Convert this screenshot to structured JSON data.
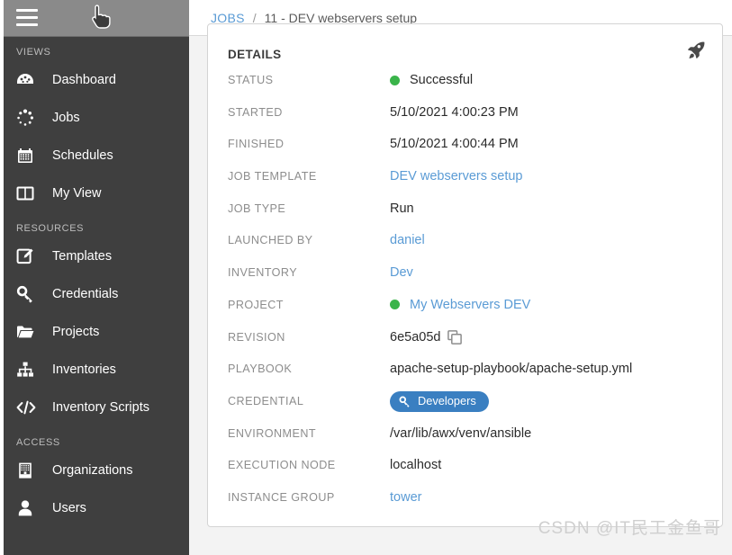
{
  "topbar": {
    "menu_icon": "hamburger-icon",
    "cursor": "pointing-hand-cursor"
  },
  "sidebar": {
    "sections": [
      {
        "title": "VIEWS",
        "items": [
          {
            "label": "Dashboard",
            "icon": "dashboard-icon"
          },
          {
            "label": "Jobs",
            "icon": "jobs-spinner-icon"
          },
          {
            "label": "Schedules",
            "icon": "calendar-icon"
          },
          {
            "label": "My View",
            "icon": "columns-icon"
          }
        ]
      },
      {
        "title": "RESOURCES",
        "items": [
          {
            "label": "Templates",
            "icon": "template-edit-icon"
          },
          {
            "label": "Credentials",
            "icon": "key-icon"
          },
          {
            "label": "Projects",
            "icon": "folder-icon"
          },
          {
            "label": "Inventories",
            "icon": "sitemap-icon"
          },
          {
            "label": "Inventory Scripts",
            "icon": "code-icon"
          }
        ]
      },
      {
        "title": "ACCESS",
        "items": [
          {
            "label": "Organizations",
            "icon": "building-icon"
          },
          {
            "label": "Users",
            "icon": "user-icon"
          }
        ]
      }
    ]
  },
  "breadcrumb": {
    "root": "JOBS",
    "separator": "/",
    "current": "11 - DEV webservers setup"
  },
  "details": {
    "title": "DETAILS",
    "relaunch_icon": "rocket-icon",
    "rows": [
      {
        "label": "STATUS",
        "value": "Successful",
        "kind": "status",
        "dot_color": "#3ab44a"
      },
      {
        "label": "STARTED",
        "value": "5/10/2021 4:00:23 PM",
        "kind": "text"
      },
      {
        "label": "FINISHED",
        "value": "5/10/2021 4:00:44 PM",
        "kind": "text"
      },
      {
        "label": "JOB TEMPLATE",
        "value": "DEV webservers setup",
        "kind": "link"
      },
      {
        "label": "JOB TYPE",
        "value": "Run",
        "kind": "text"
      },
      {
        "label": "LAUNCHED BY",
        "value": "daniel",
        "kind": "link"
      },
      {
        "label": "INVENTORY",
        "value": "Dev",
        "kind": "link"
      },
      {
        "label": "PROJECT",
        "value": "My Webservers DEV",
        "kind": "status-link",
        "dot_color": "#3ab44a"
      },
      {
        "label": "REVISION",
        "value": "6e5a05d",
        "kind": "revision",
        "icon": "copy-icon"
      },
      {
        "label": "PLAYBOOK",
        "value": "apache-setup-playbook/apache-setup.yml",
        "kind": "text"
      },
      {
        "label": "CREDENTIAL",
        "value": "Developers",
        "kind": "badge",
        "icon": "key-icon",
        "badge_color": "#3a7fc1"
      },
      {
        "label": "ENVIRONMENT",
        "value": "/var/lib/awx/venv/ansible",
        "kind": "text"
      },
      {
        "label": "EXECUTION NODE",
        "value": "localhost",
        "kind": "text"
      },
      {
        "label": "INSTANCE GROUP",
        "value": "tower",
        "kind": "link"
      }
    ]
  },
  "watermark": {
    "text": "CSDN @IT民工金鱼哥"
  },
  "colors": {
    "sidebar_bg": "#3f3f3f",
    "topbar_bg": "#8a8a8a",
    "link": "#5a9bd5",
    "success": "#3ab44a",
    "badge": "#3a7fc1",
    "page_bg": "#f3f3f3"
  }
}
